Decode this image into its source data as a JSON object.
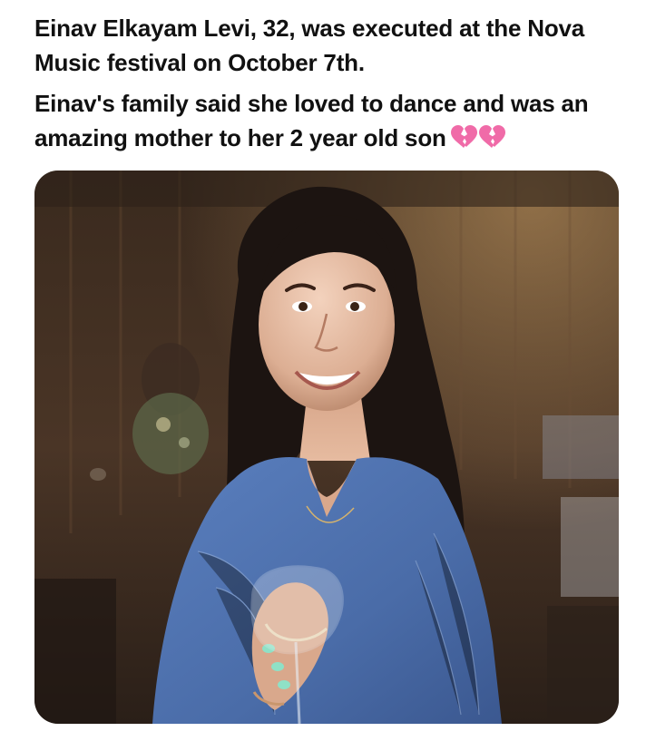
{
  "post": {
    "caption_line_1": "Einav Elkayam Levi, 32, was executed at the Nova Music festival on October 7th.",
    "caption_line_2": "Einav's family said she loved to dance and was an amazing mother to her 2 year old son",
    "emoji": [
      "broken-heart-icon",
      "broken-heart-icon"
    ],
    "emoji_color": "#f06ba8"
  },
  "colors": {
    "background": "#ffffff",
    "text": "#111111",
    "dress": "#4f73b0",
    "hair": "#1c1411"
  }
}
